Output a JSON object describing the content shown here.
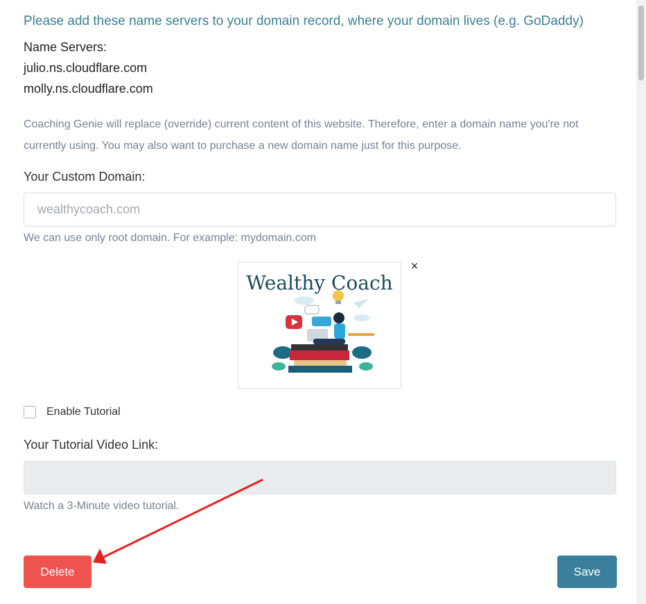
{
  "nameservers": {
    "instruction": "Please add these name servers to your domain record, where your domain lives (e.g. GoDaddy)",
    "label": "Name Servers:",
    "servers": [
      "julio.ns.cloudflare.com",
      "molly.ns.cloudflare.com"
    ]
  },
  "notice": "Coaching Genie will replace (override) current content of this website. Therefore, enter a domain name you're not currently using. You may also want to purchase a new domain name just for this purpose.",
  "custom_domain": {
    "label": "Your Custom Domain:",
    "placeholder": "wealthycoach.com",
    "value": "",
    "help": "We can use only root domain. For example: mydomain.com"
  },
  "logo": {
    "title": "Wealthy Coach",
    "remove_icon": "close-icon",
    "remove_glyph": "×"
  },
  "tutorial": {
    "checkbox_label": "Enable Tutorial",
    "checked": false,
    "video_label": "Your Tutorial Video Link:",
    "video_value": "",
    "help": "Watch a 3-Minute video tutorial."
  },
  "buttons": {
    "delete": "Delete",
    "save": "Save"
  },
  "colors": {
    "accent": "#3a8096",
    "delete": "#ef5350",
    "save": "#3a7f9c",
    "annotation_arrow": "#e8201e"
  }
}
